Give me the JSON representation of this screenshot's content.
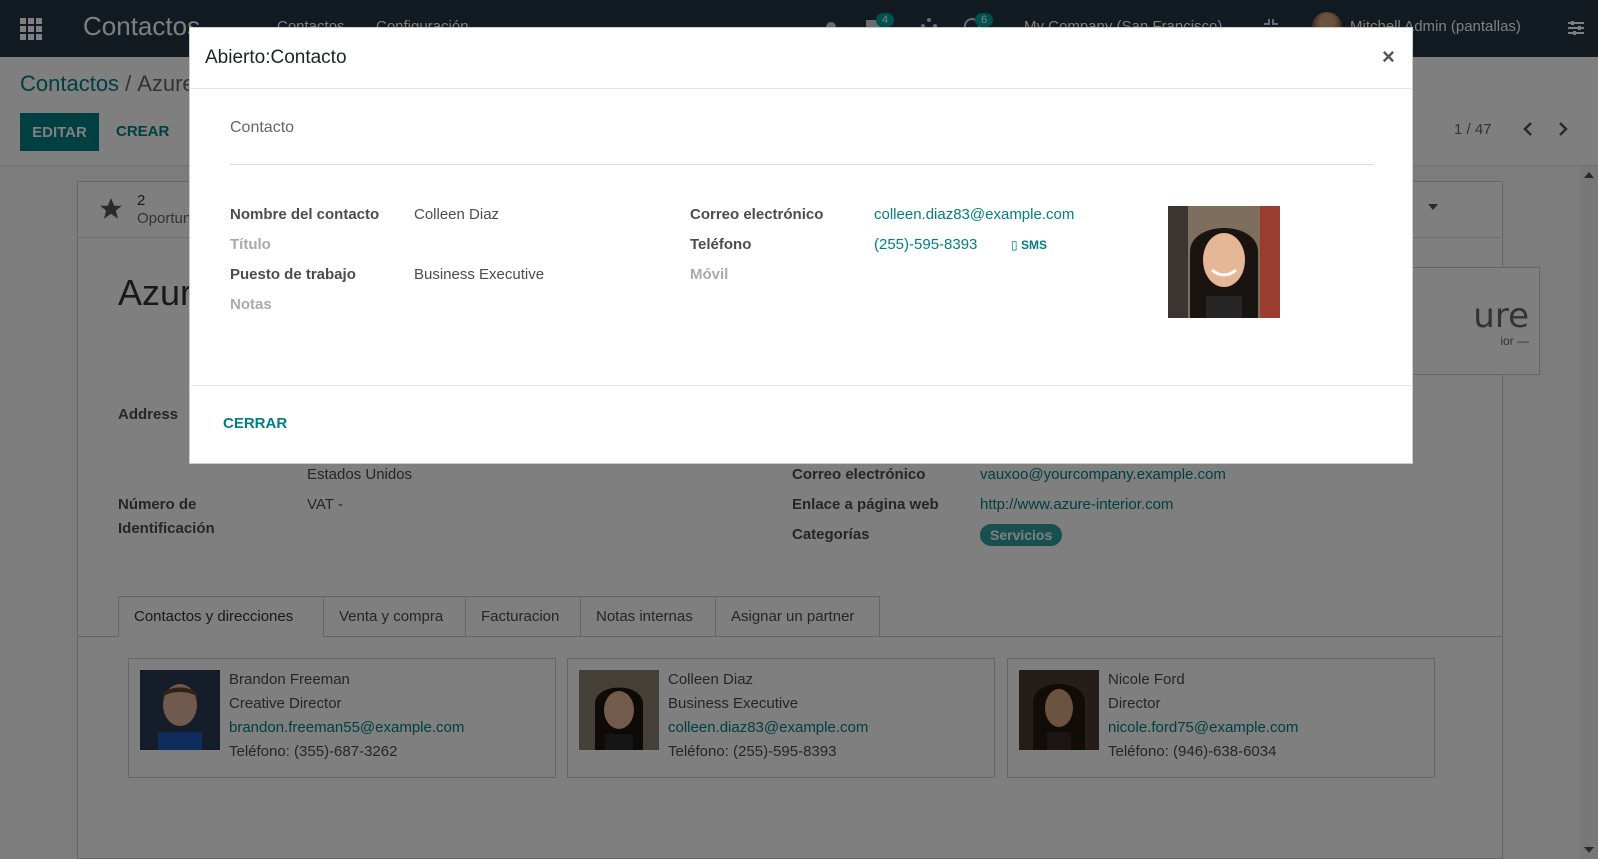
{
  "navbar": {
    "app_title": "Contactos",
    "menu": [
      "Contactos",
      "Configuración"
    ],
    "messages_badge": "4",
    "activity_badge": "6",
    "company": "My Company (San Francisco)",
    "user": "Mitchell Admin (pantallas)"
  },
  "control": {
    "breadcrumb_root": "Contactos",
    "breadcrumb_current": "Azure Interior",
    "edit_label": "EDITAR",
    "create_label": "CREAR",
    "pager": "1 / 47"
  },
  "record": {
    "stat_count": "2",
    "stat_label": "Oportunidades",
    "title": "Azure Interior",
    "logo_text": "ure",
    "logo_sub": "ior —",
    "address_label": "Address",
    "country": "Estados Unidos",
    "vat_label_line1": "Número de",
    "vat_label_line2": "Identificación",
    "vat_value": "VAT -",
    "email_label": "Correo electrónico",
    "email_value": "vauxoo@yourcompany.example.com",
    "website_label": "Enlace a página web",
    "website_value": "http://www.azure-interior.com",
    "categories_label": "Categorías",
    "category_tag": "Servicios"
  },
  "tabs": [
    {
      "label": "Contactos y direcciones"
    },
    {
      "label": "Venta y compra"
    },
    {
      "label": "Facturacion"
    },
    {
      "label": "Notas internas"
    },
    {
      "label": "Asignar un partner"
    }
  ],
  "contacts": [
    {
      "name": "Brandon Freeman",
      "job": "Creative Director",
      "email": "brandon.freeman55@example.com",
      "phone": "Teléfono: (355)-687-3262"
    },
    {
      "name": "Colleen Diaz",
      "job": "Business Executive",
      "email": "colleen.diaz83@example.com",
      "phone": "Teléfono: (255)-595-8393"
    },
    {
      "name": "Nicole Ford",
      "job": "Director",
      "email": "nicole.ford75@example.com",
      "phone": "Teléfono: (946)-638-6034"
    }
  ],
  "modal": {
    "title": "Abierto:Contacto",
    "close_symbol": "×",
    "section": "Contacto",
    "name_label": "Nombre del contacto",
    "name_value": "Colleen Diaz",
    "title_label": "Título",
    "job_label": "Puesto de trabajo",
    "job_value": "Business Executive",
    "notes_label": "Notas",
    "email_label": "Correo electrónico",
    "email_value": "colleen.diaz83@example.com",
    "phone_label": "Teléfono",
    "phone_value": "(255)-595-8393",
    "sms_label": "SMS",
    "mobile_label": "Móvil",
    "close_button": "CERRAR"
  },
  "colors": {
    "navbar": "#243742",
    "primary": "#017e84",
    "tag": "#30a0a0"
  }
}
